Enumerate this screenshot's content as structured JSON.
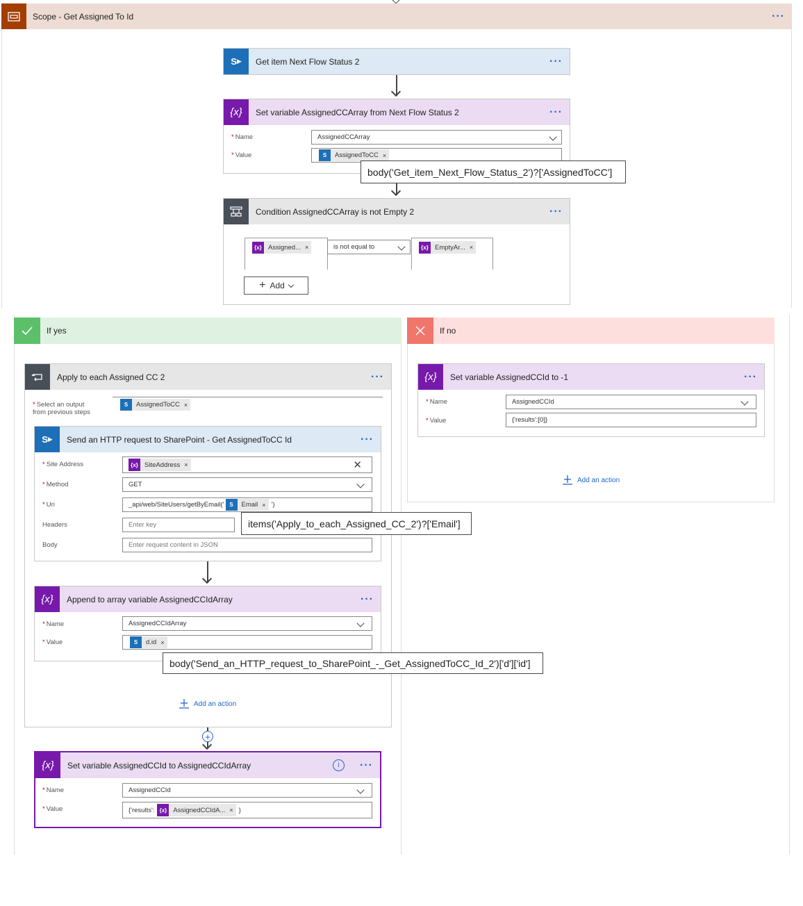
{
  "scope": {
    "title": "Scope - Get Assigned To Id"
  },
  "get_item": {
    "title": "Get item Next Flow Status 2"
  },
  "set_var1": {
    "title": "Set variable AssignedCCArray from Next Flow Status 2",
    "name_label": "Name",
    "name_value": "AssignedCCArray",
    "value_label": "Value",
    "value_token": "AssignedToCC",
    "tooltip": "body('Get_item_Next_Flow_Status_2')?['AssignedToCC']"
  },
  "condition": {
    "title": "Condition AssignedCCArray is not Empty 2",
    "left_token": "Assigned...",
    "operator": "is not equal to",
    "right_token": "EmptyAr...",
    "add_label": "Add"
  },
  "if_yes": {
    "label": "If yes"
  },
  "if_no": {
    "label": "If no"
  },
  "apply_each": {
    "title": "Apply to each Assigned CC 2",
    "select_label_1": "Select an output",
    "select_label_2": "from previous steps",
    "select_token": "AssignedToCC",
    "add_action": "Add an action"
  },
  "http": {
    "title": "Send an HTTP request to SharePoint - Get AssignedToCC Id",
    "site_label": "Site Address",
    "site_token": "SiteAddress",
    "method_label": "Method",
    "method_value": "GET",
    "uri_label": "Uri",
    "uri_prefix": "_api/web/SiteUsers/getByEmail('",
    "uri_token": "Email",
    "uri_suffix": "')",
    "headers_label": "Headers",
    "headers_placeholder": "Enter key",
    "body_label": "Body",
    "body_placeholder": "Enter request content in JSON",
    "tooltip": "items('Apply_to_each_Assigned_CC_2')?['Email']"
  },
  "append": {
    "title": "Append to array variable AssignedCCIdArray",
    "name_label": "Name",
    "name_value": "AssignedCCIdArray",
    "value_label": "Value",
    "value_token": "d.id",
    "tooltip": "body('Send_an_HTTP_request_to_SharePoint_-_Get_AssignedToCC_Id_2')['d']['id']"
  },
  "set_var_final": {
    "title": "Set variable AssignedCCId to AssignedCCIdArray",
    "name_label": "Name",
    "name_value": "AssignedCCId",
    "value_label": "Value",
    "value_prefix": "{'results':",
    "value_token": "AssignedCCIdA...",
    "value_suffix": "}"
  },
  "set_var_no": {
    "title": "Set variable AssignedCCId to -1",
    "name_label": "Name",
    "name_value": "AssignedCCId",
    "value_label": "Value",
    "value_value": "{'results':[0]}",
    "add_action": "Add an action"
  },
  "colors": {
    "scope": "#a33e00",
    "sharepoint": "#1d6fb8",
    "variable": "#7719aa",
    "condition": "#484f58",
    "yes": "#5cbf6a",
    "no": "#f0766b"
  }
}
